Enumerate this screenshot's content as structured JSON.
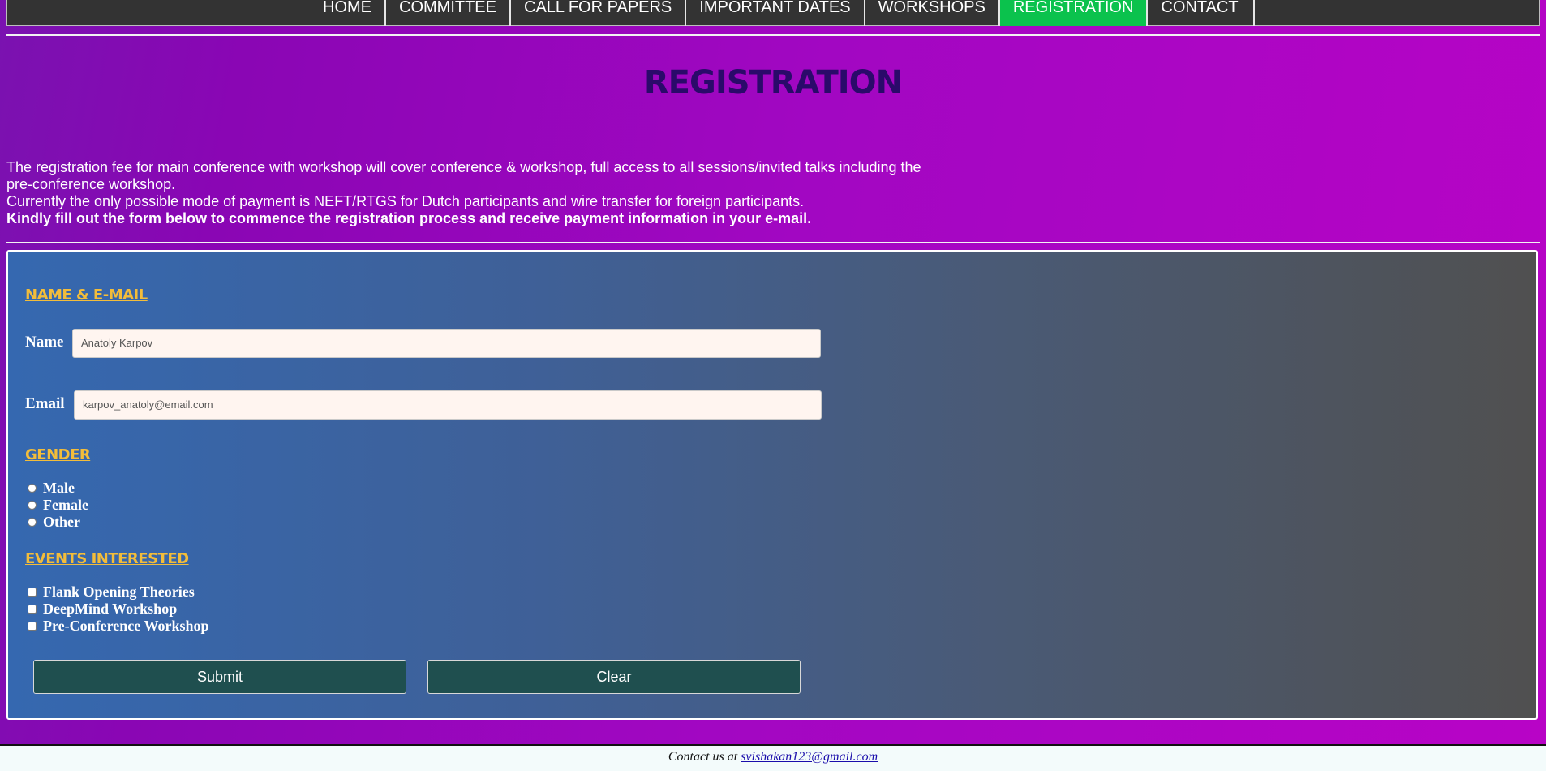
{
  "nav": {
    "items": [
      {
        "label": "HOME"
      },
      {
        "label": "COMMITTEE"
      },
      {
        "label": "CALL FOR PAPERS"
      },
      {
        "label": "IMPORTANT DATES"
      },
      {
        "label": "WORKSHOPS"
      },
      {
        "label": "REGISTRATION",
        "active": true
      },
      {
        "label": "CONTACT"
      }
    ]
  },
  "page": {
    "title": "REGISTRATION",
    "intro_line1": "The registration fee for main conference with workshop will cover conference & workshop, full access to all sessions/invited talks including the pre-conference workshop.",
    "intro_line2": "Currently the only possible mode of payment is NEFT/RTGS for Dutch participants and wire transfer for foreign participants.",
    "intro_bold": "Kindly fill out the form below to commence the registration process and receive payment information in your e-mail."
  },
  "form": {
    "section_name_email": "NAME & E-MAIL",
    "name_label": "Name",
    "name_placeholder": "Anatoly Karpov",
    "email_label": "Email",
    "email_placeholder": "karpov_anatoly@email.com",
    "section_gender": "GENDER",
    "gender_options": [
      "Male",
      "Female",
      "Other"
    ],
    "section_events": "EVENTS INTERESTED",
    "event_options": [
      "Flank Opening Theories",
      "DeepMind Workshop",
      "Pre-Conference Workshop"
    ],
    "submit_label": "Submit",
    "clear_label": "Clear"
  },
  "footer": {
    "text": "Contact us at",
    "email": "svishakan123@gmail.com"
  },
  "colors": {
    "nav_active": "#0bc24d",
    "section_title": "#f3bd3a",
    "button_bg": "#1f4f4f",
    "title": "#2a0a6a"
  }
}
